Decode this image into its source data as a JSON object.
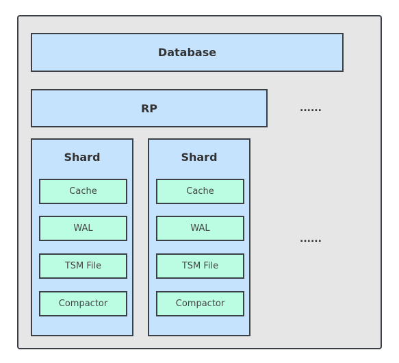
{
  "colors": {
    "outer_bg": "#e6e6e6",
    "layer_bg": "#c5e3fd",
    "component_bg": "#bbfde3",
    "border": "#3a3f45"
  },
  "database": {
    "label": "Database"
  },
  "rp": {
    "label": "RP"
  },
  "ellipsis_rp": "......",
  "ellipsis_shards": "......",
  "shards": [
    {
      "title": "Shard",
      "components": [
        "Cache",
        "WAL",
        "TSM File",
        "Compactor"
      ]
    },
    {
      "title": "Shard",
      "components": [
        "Cache",
        "WAL",
        "TSM File",
        "Compactor"
      ]
    }
  ]
}
